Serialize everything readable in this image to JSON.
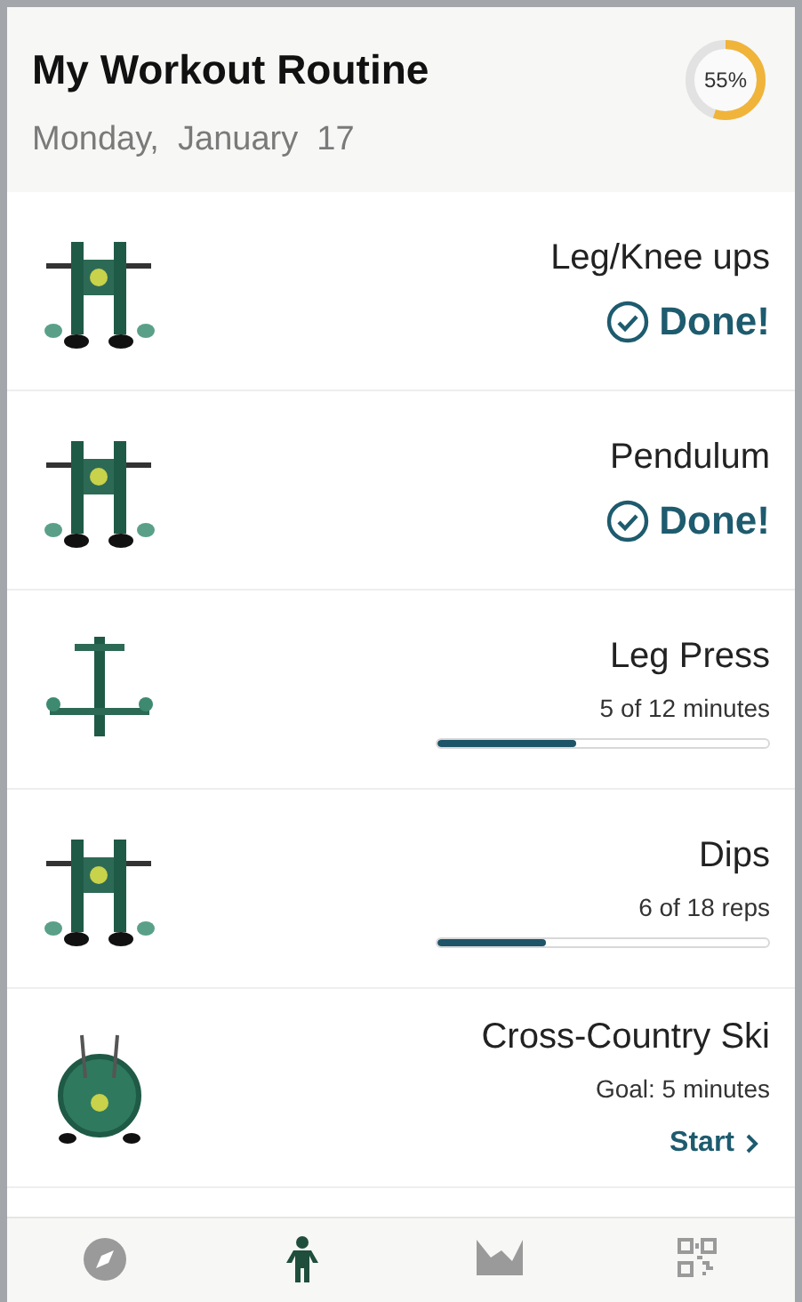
{
  "header": {
    "title": "My Workout Routine",
    "date": "Monday,  January  17",
    "progress": {
      "label": "55%",
      "level": 0.55
    }
  },
  "exercises": [
    {
      "kind": "done",
      "name": "Leg/Knee ups",
      "status": "Done!"
    },
    {
      "kind": "done",
      "name": "Pendulum",
      "status": "Done!"
    },
    {
      "kind": "progress",
      "name": "Leg Press",
      "detail": "5 of 12 minutes",
      "level": 0.42
    },
    {
      "kind": "progress",
      "name": "Dips",
      "detail": "6 of 18 reps",
      "level": 0.33
    },
    {
      "kind": "start",
      "name": "Cross-Country Ski",
      "detail": "Goal: 5 minutes",
      "action": "Start"
    }
  ],
  "nav": [
    {
      "kind": "explore",
      "selected": false
    },
    {
      "kind": "workout",
      "selected": true
    },
    {
      "kind": "progress",
      "selected": false
    },
    {
      "kind": "scan",
      "selected": false
    }
  ]
}
